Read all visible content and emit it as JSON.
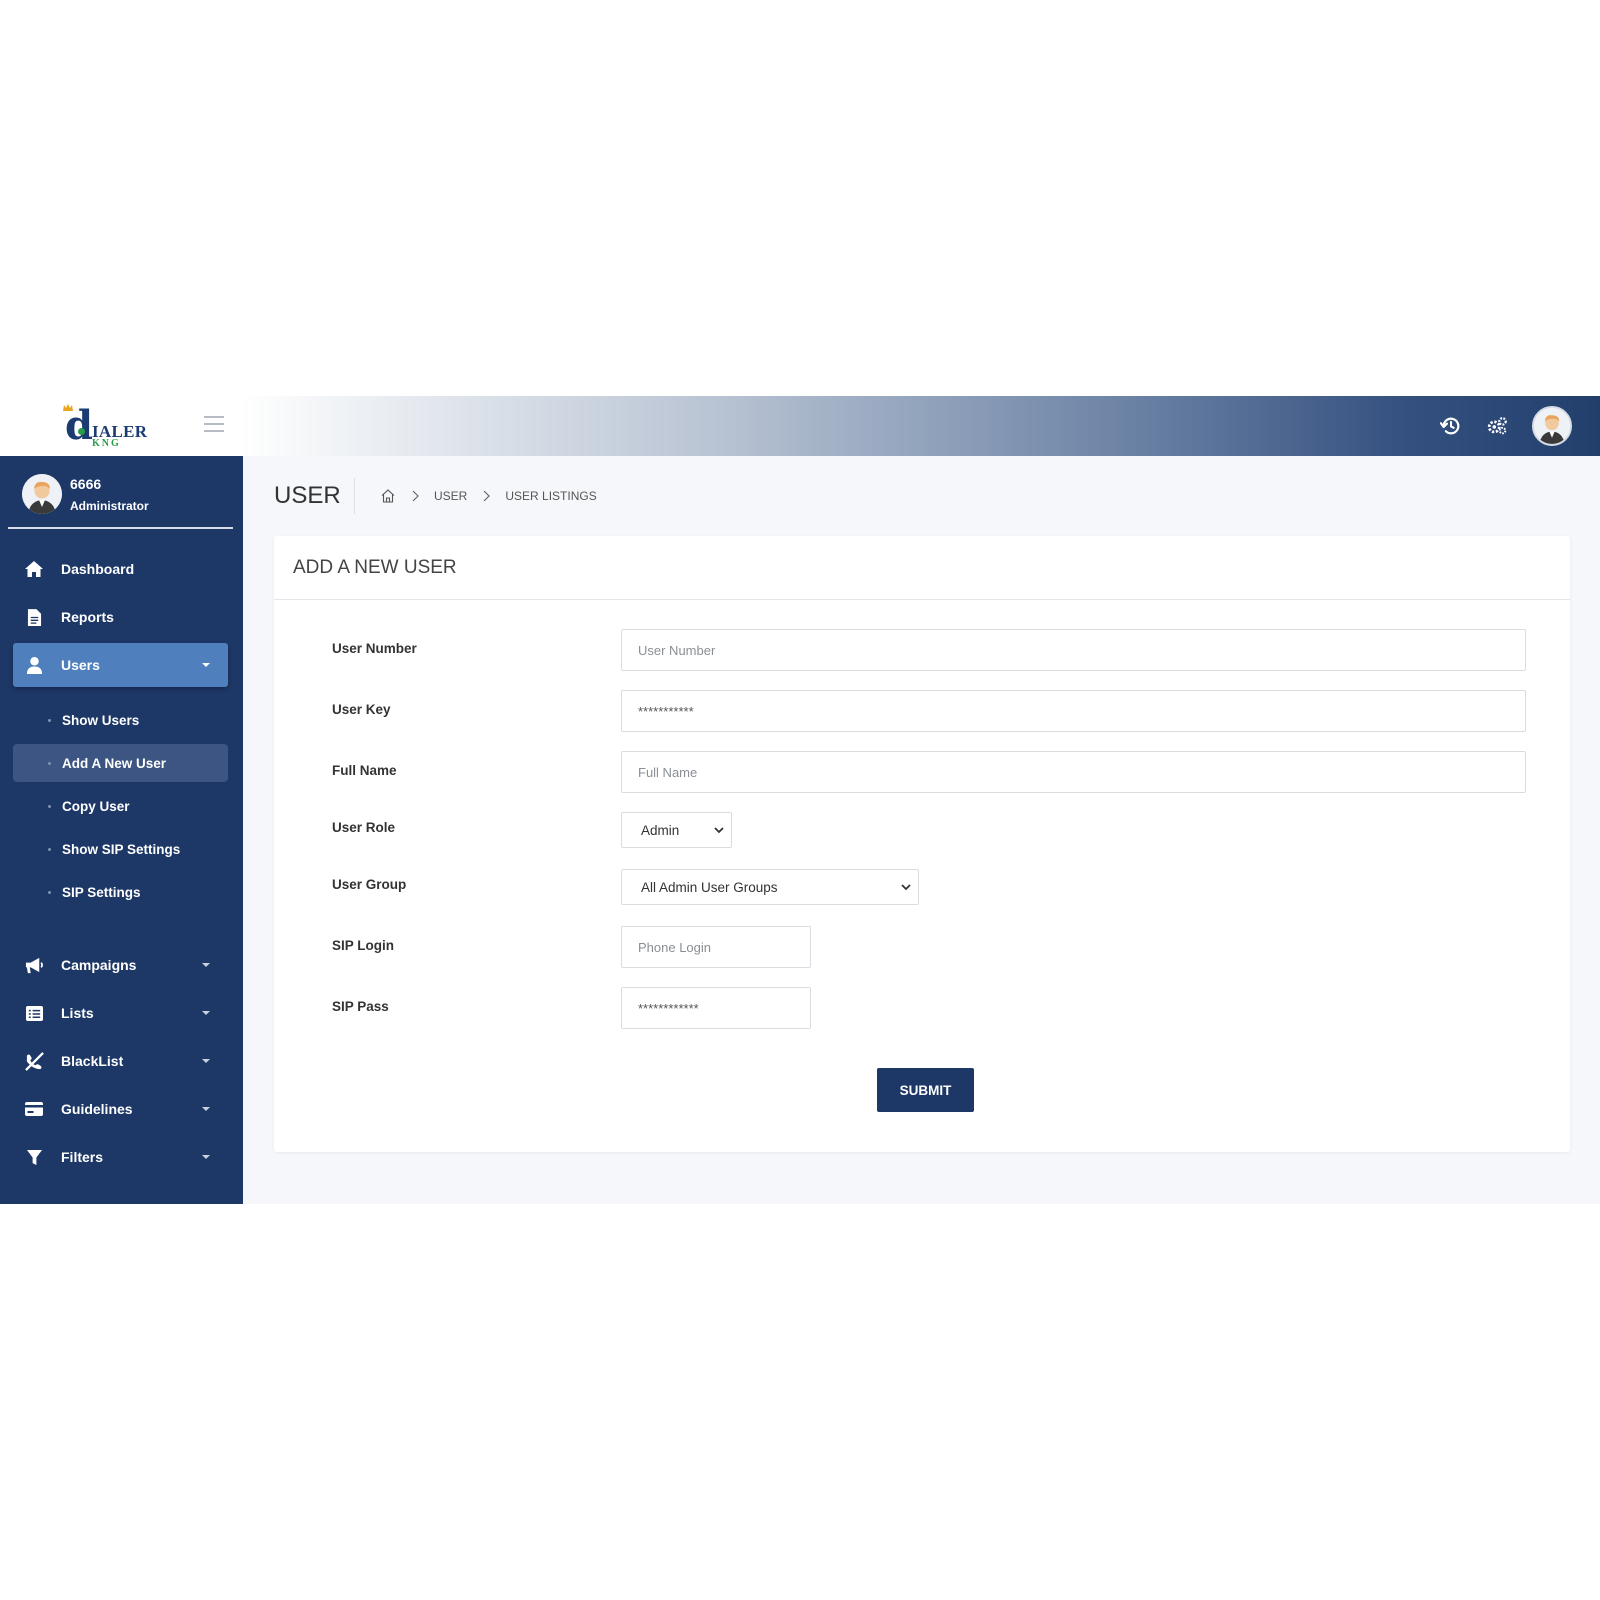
{
  "brand": {
    "logo_main": "IALER",
    "logo_sub": "KNG"
  },
  "header": {
    "icons": [
      "history-icon",
      "gears-icon",
      "avatar"
    ]
  },
  "profile": {
    "name": "6666",
    "role": "Administrator"
  },
  "sidebar": {
    "items": [
      {
        "label": "Dashboard",
        "icon": "home-icon"
      },
      {
        "label": "Reports",
        "icon": "document-icon"
      },
      {
        "label": "Users",
        "icon": "user-icon",
        "active": true
      },
      {
        "label": "Campaigns",
        "icon": "megaphone-icon"
      },
      {
        "label": "Lists",
        "icon": "list-icon"
      },
      {
        "label": "BlackList",
        "icon": "phone-slash-icon"
      },
      {
        "label": "Guidelines",
        "icon": "card-icon"
      },
      {
        "label": "Filters",
        "icon": "filter-icon"
      }
    ],
    "user_subitems": [
      {
        "label": "Show Users"
      },
      {
        "label": "Add A New User",
        "active": true
      },
      {
        "label": "Copy User"
      },
      {
        "label": "Show SIP Settings"
      },
      {
        "label": "SIP Settings"
      }
    ]
  },
  "page": {
    "title": "USER",
    "breadcrumb": [
      "USER",
      "USER LISTINGS"
    ]
  },
  "form": {
    "title": "ADD A NEW USER",
    "fields": [
      {
        "label": "User Number",
        "placeholder": "User Number",
        "value": ""
      },
      {
        "label": "User Key",
        "placeholder": "",
        "value": "***********"
      },
      {
        "label": "Full Name",
        "placeholder": "Full Name",
        "value": ""
      },
      {
        "label": "User Role",
        "value": "Admin"
      },
      {
        "label": "User Group",
        "value": "All Admin User Groups"
      },
      {
        "label": "SIP Login",
        "placeholder": "Phone Login",
        "value": ""
      },
      {
        "label": "SIP Pass",
        "placeholder": "",
        "value": "************"
      }
    ],
    "submit_label": "SUBMIT"
  },
  "colors": {
    "sidebar_bg": "#1d3766",
    "active_item": "#4f7fbd",
    "active_subitem": "#3c5582",
    "submit_bg": "#1d3766"
  }
}
